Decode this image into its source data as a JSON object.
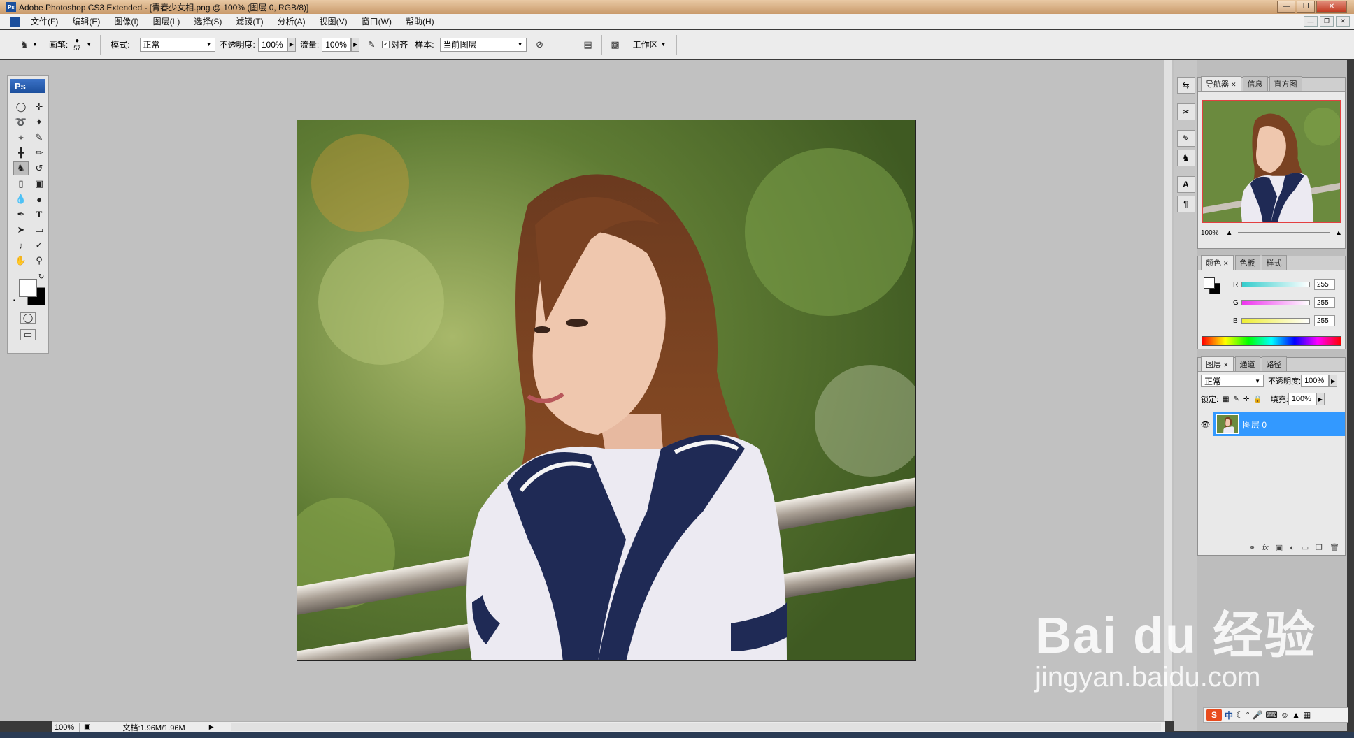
{
  "window": {
    "title": "Adobe Photoshop CS3 Extended - [青春少女相.png @ 100% (图层 0, RGB/8)]",
    "app_icon": "Ps",
    "controls": [
      "minimize-icon",
      "restore-icon",
      "close-icon"
    ]
  },
  "menu": {
    "items": [
      "文件(F)",
      "编辑(E)",
      "图像(I)",
      "图层(L)",
      "选择(S)",
      "滤镜(T)",
      "分析(A)",
      "视图(V)",
      "窗口(W)",
      "帮助(H)"
    ]
  },
  "options": {
    "brush_label": "画笔:",
    "brush_size": "57",
    "mode_label": "模式:",
    "mode_value": "正常",
    "opacity_label": "不透明度:",
    "opacity_value": "100%",
    "flow_label": "流量:",
    "flow_value": "100%",
    "aligned_label": "对齐",
    "sample_label": "样本:",
    "sample_value": "当前图层",
    "workspace_label": "工作区"
  },
  "toolbox": {
    "logo": "Ps",
    "tools": [
      "marquee-icon",
      "move-icon",
      "lasso-icon",
      "magic-wand-icon",
      "crop-icon",
      "slice-icon",
      "healing-brush-icon",
      "brush-icon",
      "clone-stamp-icon",
      "history-brush-icon",
      "eraser-icon",
      "gradient-icon",
      "blur-icon",
      "dodge-icon",
      "pen-icon",
      "type-icon",
      "path-selection-icon",
      "shape-icon",
      "notes-icon",
      "eyedropper-icon",
      "hand-icon",
      "zoom-icon"
    ],
    "active_tool": "clone-stamp-icon"
  },
  "status": {
    "zoom": "100%",
    "doc": "文档:1.96M/1.96M"
  },
  "navigator": {
    "tabs": [
      "导航器",
      "信息",
      "直方图"
    ],
    "zoom": "100%"
  },
  "color": {
    "tabs": [
      "颜色",
      "色板",
      "样式"
    ],
    "channels": [
      {
        "name": "R",
        "value": "255"
      },
      {
        "name": "G",
        "value": "255"
      },
      {
        "name": "B",
        "value": "255"
      }
    ],
    "ramp_colors": [
      "#33cccc",
      "#ee33ee",
      "#eeee33"
    ]
  },
  "layers": {
    "tabs": [
      "图层",
      "通道",
      "路径"
    ],
    "blend_mode": "正常",
    "opacity_label": "不透明度:",
    "opacity_value": "100%",
    "lock_label": "锁定:",
    "fill_label": "填充:",
    "fill_value": "100%",
    "items": [
      {
        "name": "图层 0"
      }
    ]
  },
  "watermark": {
    "logo": "Bai du 经验",
    "url": "jingyan.baidu.com"
  },
  "tray": {
    "s_icon": "S",
    "ime": "中"
  }
}
